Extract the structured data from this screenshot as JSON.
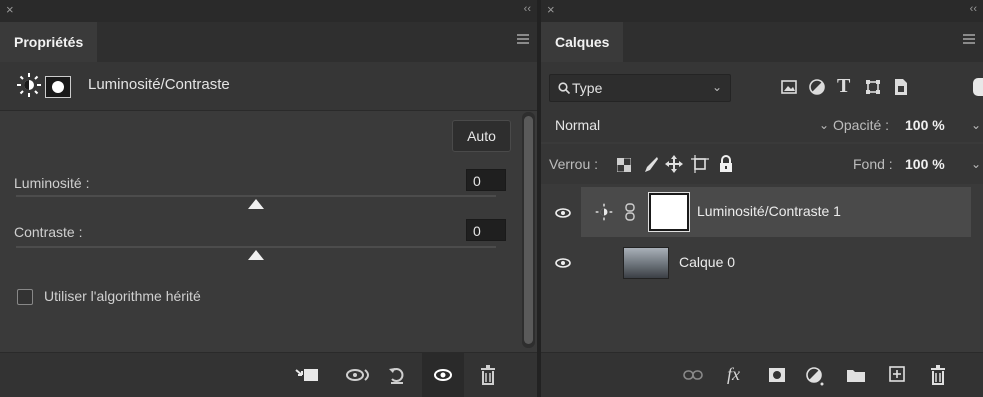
{
  "properties": {
    "close_glyph": "×",
    "collapse_glyph": "‹‹",
    "tab": "Propriétés",
    "header_title": "Luminosité/Contraste",
    "auto_label": "Auto",
    "brightness_label": "Luminosité :",
    "brightness_value": "0",
    "contrast_label": "Contraste :",
    "contrast_value": "0",
    "legacy_label": "Utiliser l'algorithme hérité",
    "legacy_checked": false,
    "brightness_level": 0.5,
    "contrast_level": 0.5
  },
  "layers": {
    "close_glyph": "×",
    "collapse_glyph": "‹‹",
    "tab": "Calques",
    "filter_label": "Type",
    "blend_mode": "Normal",
    "opacity_label": "Opacité :",
    "opacity_value": "100 %",
    "lock_label": "Verrou :",
    "fill_label": "Fond :",
    "fill_value": "100 %",
    "items": [
      {
        "name": "Luminosité/Contraste 1",
        "selected": true
      },
      {
        "name": "Calque 0",
        "selected": false
      }
    ],
    "footer_fx": "fx"
  },
  "colors": {
    "panel": "#3a3a3a",
    "selected_row": "#4a4a4a",
    "field": "#1f1f1f"
  }
}
